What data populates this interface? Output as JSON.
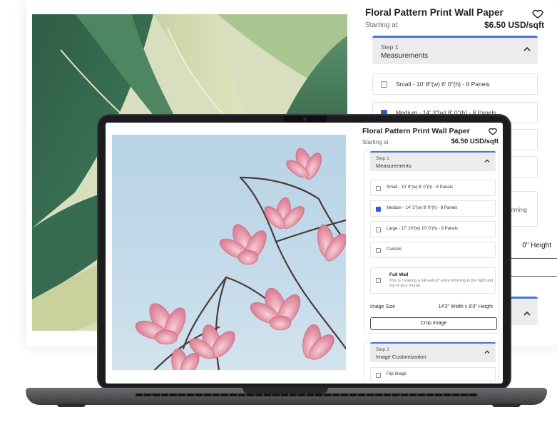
{
  "product": {
    "title": "Floral Pattern Print Wall Paper",
    "starting_label": "Starting at",
    "price": "$6.50 USD/sqft"
  },
  "background_panel": {
    "step_kicker": "Step 1",
    "step_title": "Measurements",
    "options": [
      {
        "label": "Small - 10' 8\"(w) 6' 0\"(h) - 6 Panels",
        "checked": false
      },
      {
        "label": "Medium - 14' 3\"(w) 8' 0\"(h) - 8 Panels",
        "checked": true
      }
    ],
    "partial_text_trimming": "mming",
    "partial_text_height": "0\" Height"
  },
  "screen": {
    "step1": {
      "kicker": "Step 1",
      "title": "Measurements",
      "options": [
        {
          "label": "Small - 10' 8\"(w) 6' 0\"(h) - 6 Panels",
          "checked": false
        },
        {
          "label": "Medium - 14' 3\"(w) 8' 0\"(h) - 8 Panels",
          "checked": true
        },
        {
          "label": "Large - 17' 10\"(w) 10' 0\"(h) - 9 Panels",
          "checked": false
        },
        {
          "label": "Custom",
          "checked": false
        }
      ],
      "full_wall": {
        "title": "Full Wall",
        "description": "This is covering a full wall (2\" extra trimming to the right and top of your mural)"
      },
      "image_size_label": "Image Size",
      "image_size_value": "14'3\" Width x 8'0\" Height",
      "crop_label": "Crop Image"
    },
    "step2": {
      "kicker": "Step 2",
      "title": "Image Customization",
      "flip_label": "Flip Image"
    }
  },
  "icons": {
    "favorite": "heart-icon",
    "collapse": "chevron-up-icon"
  },
  "colors": {
    "accent": "#4a76d6",
    "checkbox_checked": "#2b5fd9",
    "laptop_body": "#1c1c1e"
  }
}
